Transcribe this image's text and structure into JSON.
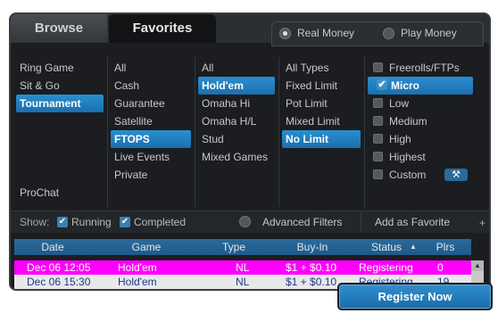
{
  "tabs": {
    "browse": "Browse",
    "favorites": "Favorites"
  },
  "money": {
    "real": "Real Money",
    "play": "Play Money"
  },
  "game_types": {
    "items": [
      "Ring Game",
      "Sit & Go",
      "Tournament"
    ],
    "prochat": "ProChat"
  },
  "categories": {
    "items": [
      "All",
      "Cash",
      "Guarantee",
      "Satellite",
      "FTOPS",
      "Live Events",
      "Private"
    ]
  },
  "games": {
    "items": [
      "All",
      "Hold'em",
      "Omaha Hi",
      "Omaha H/L",
      "Stud",
      "Mixed Games"
    ]
  },
  "limits": {
    "items": [
      "All Types",
      "Fixed Limit",
      "Pot Limit",
      "Mixed Limit",
      "No Limit"
    ]
  },
  "stakes": {
    "items": [
      "Freerolls/FTPs",
      "Micro",
      "Low",
      "Medium",
      "High",
      "Highest",
      "Custom"
    ]
  },
  "filters": {
    "show": "Show:",
    "running": "Running",
    "completed": "Completed",
    "advanced": "Advanced Filters",
    "add_favorite": "Add as Favorite"
  },
  "table": {
    "headers": [
      "Date",
      "Game",
      "Type",
      "Buy-In",
      "Status",
      "Plrs"
    ],
    "rows": [
      {
        "date": "Dec 06 12:05",
        "game": "Hold'em",
        "type": "NL",
        "buyin": "$1 + $0.10",
        "status": "Registering",
        "plrs": "0"
      },
      {
        "date": "Dec 06 15:30",
        "game": "Hold'em",
        "type": "NL",
        "buyin": "$1 + $0.10",
        "status": "Registering",
        "plrs": "19"
      }
    ]
  },
  "register_button": "Register Now",
  "colors": {
    "accent": "#1a6fae",
    "highlight_row": "#ff00ff",
    "panel": "#1b1d20"
  }
}
